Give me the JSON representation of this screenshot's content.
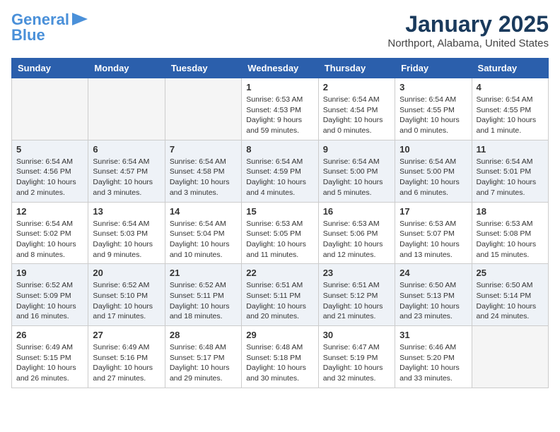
{
  "header": {
    "logo_line1": "General",
    "logo_line2": "Blue",
    "month_title": "January 2025",
    "location": "Northport, Alabama, United States"
  },
  "weekdays": [
    "Sunday",
    "Monday",
    "Tuesday",
    "Wednesday",
    "Thursday",
    "Friday",
    "Saturday"
  ],
  "weeks": [
    [
      {
        "day": "",
        "sunrise": "",
        "sunset": "",
        "daylight": "",
        "empty": true
      },
      {
        "day": "",
        "sunrise": "",
        "sunset": "",
        "daylight": "",
        "empty": true
      },
      {
        "day": "",
        "sunrise": "",
        "sunset": "",
        "daylight": "",
        "empty": true
      },
      {
        "day": "1",
        "sunrise": "Sunrise: 6:53 AM",
        "sunset": "Sunset: 4:53 PM",
        "daylight": "Daylight: 9 hours and 59 minutes."
      },
      {
        "day": "2",
        "sunrise": "Sunrise: 6:54 AM",
        "sunset": "Sunset: 4:54 PM",
        "daylight": "Daylight: 10 hours and 0 minutes."
      },
      {
        "day": "3",
        "sunrise": "Sunrise: 6:54 AM",
        "sunset": "Sunset: 4:55 PM",
        "daylight": "Daylight: 10 hours and 0 minutes."
      },
      {
        "day": "4",
        "sunrise": "Sunrise: 6:54 AM",
        "sunset": "Sunset: 4:55 PM",
        "daylight": "Daylight: 10 hours and 1 minute."
      }
    ],
    [
      {
        "day": "5",
        "sunrise": "Sunrise: 6:54 AM",
        "sunset": "Sunset: 4:56 PM",
        "daylight": "Daylight: 10 hours and 2 minutes."
      },
      {
        "day": "6",
        "sunrise": "Sunrise: 6:54 AM",
        "sunset": "Sunset: 4:57 PM",
        "daylight": "Daylight: 10 hours and 3 minutes."
      },
      {
        "day": "7",
        "sunrise": "Sunrise: 6:54 AM",
        "sunset": "Sunset: 4:58 PM",
        "daylight": "Daylight: 10 hours and 3 minutes."
      },
      {
        "day": "8",
        "sunrise": "Sunrise: 6:54 AM",
        "sunset": "Sunset: 4:59 PM",
        "daylight": "Daylight: 10 hours and 4 minutes."
      },
      {
        "day": "9",
        "sunrise": "Sunrise: 6:54 AM",
        "sunset": "Sunset: 5:00 PM",
        "daylight": "Daylight: 10 hours and 5 minutes."
      },
      {
        "day": "10",
        "sunrise": "Sunrise: 6:54 AM",
        "sunset": "Sunset: 5:00 PM",
        "daylight": "Daylight: 10 hours and 6 minutes."
      },
      {
        "day": "11",
        "sunrise": "Sunrise: 6:54 AM",
        "sunset": "Sunset: 5:01 PM",
        "daylight": "Daylight: 10 hours and 7 minutes."
      }
    ],
    [
      {
        "day": "12",
        "sunrise": "Sunrise: 6:54 AM",
        "sunset": "Sunset: 5:02 PM",
        "daylight": "Daylight: 10 hours and 8 minutes."
      },
      {
        "day": "13",
        "sunrise": "Sunrise: 6:54 AM",
        "sunset": "Sunset: 5:03 PM",
        "daylight": "Daylight: 10 hours and 9 minutes."
      },
      {
        "day": "14",
        "sunrise": "Sunrise: 6:54 AM",
        "sunset": "Sunset: 5:04 PM",
        "daylight": "Daylight: 10 hours and 10 minutes."
      },
      {
        "day": "15",
        "sunrise": "Sunrise: 6:53 AM",
        "sunset": "Sunset: 5:05 PM",
        "daylight": "Daylight: 10 hours and 11 minutes."
      },
      {
        "day": "16",
        "sunrise": "Sunrise: 6:53 AM",
        "sunset": "Sunset: 5:06 PM",
        "daylight": "Daylight: 10 hours and 12 minutes."
      },
      {
        "day": "17",
        "sunrise": "Sunrise: 6:53 AM",
        "sunset": "Sunset: 5:07 PM",
        "daylight": "Daylight: 10 hours and 13 minutes."
      },
      {
        "day": "18",
        "sunrise": "Sunrise: 6:53 AM",
        "sunset": "Sunset: 5:08 PM",
        "daylight": "Daylight: 10 hours and 15 minutes."
      }
    ],
    [
      {
        "day": "19",
        "sunrise": "Sunrise: 6:52 AM",
        "sunset": "Sunset: 5:09 PM",
        "daylight": "Daylight: 10 hours and 16 minutes."
      },
      {
        "day": "20",
        "sunrise": "Sunrise: 6:52 AM",
        "sunset": "Sunset: 5:10 PM",
        "daylight": "Daylight: 10 hours and 17 minutes."
      },
      {
        "day": "21",
        "sunrise": "Sunrise: 6:52 AM",
        "sunset": "Sunset: 5:11 PM",
        "daylight": "Daylight: 10 hours and 18 minutes."
      },
      {
        "day": "22",
        "sunrise": "Sunrise: 6:51 AM",
        "sunset": "Sunset: 5:11 PM",
        "daylight": "Daylight: 10 hours and 20 minutes."
      },
      {
        "day": "23",
        "sunrise": "Sunrise: 6:51 AM",
        "sunset": "Sunset: 5:12 PM",
        "daylight": "Daylight: 10 hours and 21 minutes."
      },
      {
        "day": "24",
        "sunrise": "Sunrise: 6:50 AM",
        "sunset": "Sunset: 5:13 PM",
        "daylight": "Daylight: 10 hours and 23 minutes."
      },
      {
        "day": "25",
        "sunrise": "Sunrise: 6:50 AM",
        "sunset": "Sunset: 5:14 PM",
        "daylight": "Daylight: 10 hours and 24 minutes."
      }
    ],
    [
      {
        "day": "26",
        "sunrise": "Sunrise: 6:49 AM",
        "sunset": "Sunset: 5:15 PM",
        "daylight": "Daylight: 10 hours and 26 minutes."
      },
      {
        "day": "27",
        "sunrise": "Sunrise: 6:49 AM",
        "sunset": "Sunset: 5:16 PM",
        "daylight": "Daylight: 10 hours and 27 minutes."
      },
      {
        "day": "28",
        "sunrise": "Sunrise: 6:48 AM",
        "sunset": "Sunset: 5:17 PM",
        "daylight": "Daylight: 10 hours and 29 minutes."
      },
      {
        "day": "29",
        "sunrise": "Sunrise: 6:48 AM",
        "sunset": "Sunset: 5:18 PM",
        "daylight": "Daylight: 10 hours and 30 minutes."
      },
      {
        "day": "30",
        "sunrise": "Sunrise: 6:47 AM",
        "sunset": "Sunset: 5:19 PM",
        "daylight": "Daylight: 10 hours and 32 minutes."
      },
      {
        "day": "31",
        "sunrise": "Sunrise: 6:46 AM",
        "sunset": "Sunset: 5:20 PM",
        "daylight": "Daylight: 10 hours and 33 minutes."
      },
      {
        "day": "",
        "sunrise": "",
        "sunset": "",
        "daylight": "",
        "empty": true
      }
    ]
  ]
}
